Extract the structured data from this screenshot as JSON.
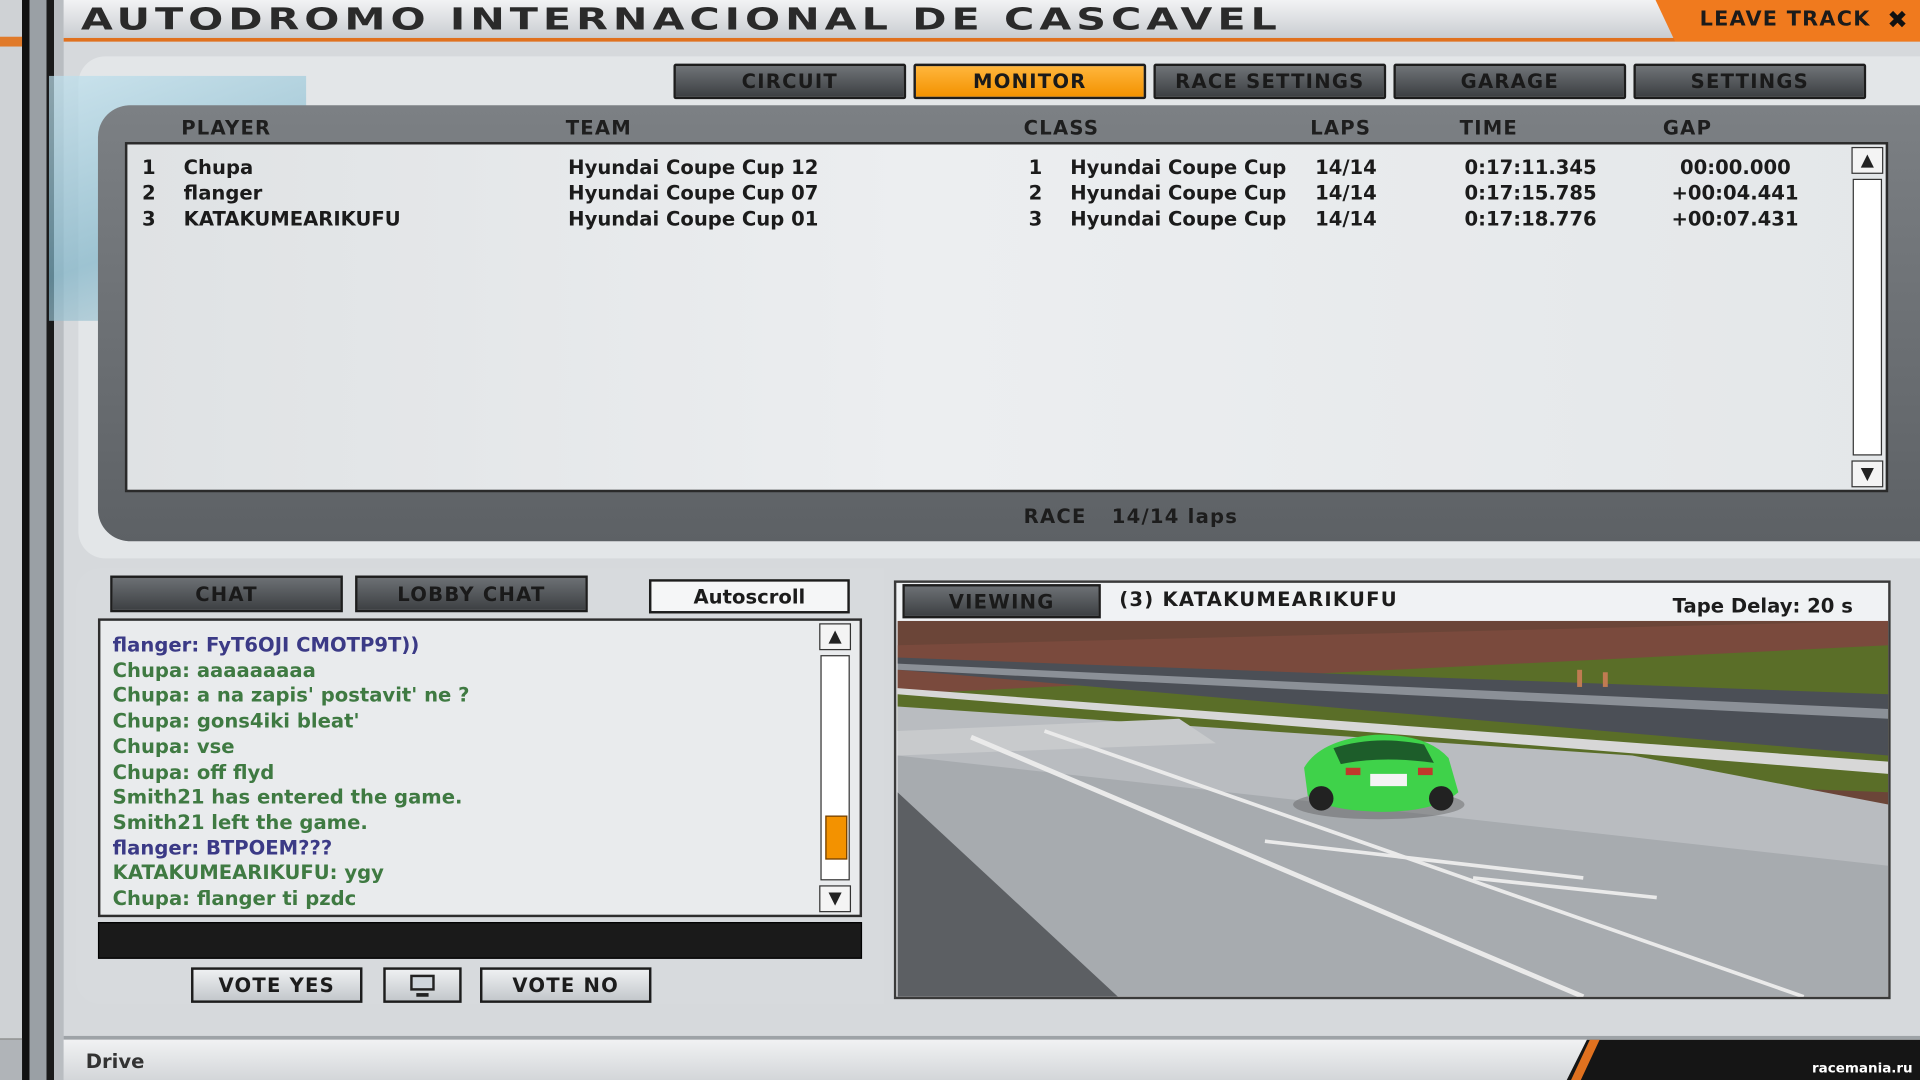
{
  "window": {
    "title": "AUTODROMO INTERNACIONAL DE CASCAVEL",
    "leave_label": "LEAVE TRACK"
  },
  "tabs": [
    {
      "label": "CIRCUIT",
      "active": false
    },
    {
      "label": "MONITOR",
      "active": true
    },
    {
      "label": "RACE SETTINGS",
      "active": false
    },
    {
      "label": "GARAGE",
      "active": false
    },
    {
      "label": "SETTINGS",
      "active": false
    }
  ],
  "standings": {
    "columns": {
      "player": "PLAYER",
      "team": "TEAM",
      "class": "CLASS",
      "laps": "LAPS",
      "time": "TIME",
      "gap": "GAP"
    },
    "rows": [
      {
        "pos": "1",
        "player": "Chupa",
        "team": "Hyundai Coupe Cup 12",
        "class_pos": "1",
        "class": "Hyundai Coupe Cup",
        "laps": "14/14",
        "time": "0:17:11.345",
        "gap": "00:00.000"
      },
      {
        "pos": "2",
        "player": "flanger",
        "team": "Hyundai Coupe Cup 07",
        "class_pos": "2",
        "class": "Hyundai Coupe Cup",
        "laps": "14/14",
        "time": "0:17:15.785",
        "gap": "+00:04.441"
      },
      {
        "pos": "3",
        "player": "KATAKUMEARIKUFU",
        "team": "Hyundai Coupe Cup 01",
        "class_pos": "3",
        "class": "Hyundai Coupe Cup",
        "laps": "14/14",
        "time": "0:17:18.776",
        "gap": "+00:07.431"
      }
    ],
    "session": "RACE",
    "session_laps": "14/14 laps"
  },
  "chat": {
    "tab_chat": "CHAT",
    "tab_lobby": "LOBBY CHAT",
    "autoscroll": "Autoscroll",
    "scroll_position": 0.9,
    "messages": [
      {
        "text": "flanger: FyT6OJI CMOTP9T))",
        "color": "#3b3a86"
      },
      {
        "text": "Chupa: aaaaaaaaa",
        "color": "#3f7a42"
      },
      {
        "text": "Chupa: a na zapis' postavit' ne ?",
        "color": "#3f7a42"
      },
      {
        "text": "Chupa: gons4iki bleat'",
        "color": "#3f7a42"
      },
      {
        "text": "Chupa: vse",
        "color": "#3f7a42"
      },
      {
        "text": "Chupa: off flyd",
        "color": "#3f7a42"
      },
      {
        "text": "Smith21 has entered the game.",
        "color": "#3f7a42"
      },
      {
        "text": "Smith21 left the game.",
        "color": "#3f7a42"
      },
      {
        "text": "flanger: BTPOEM???",
        "color": "#3b3a86"
      },
      {
        "text": "KATAKUMEARIKUFU: ygy",
        "color": "#3f7a42"
      },
      {
        "text": "Chupa: flanger ti pzdc",
        "color": "#3f7a42"
      }
    ],
    "input_value": "",
    "vote_yes": "VOTE YES",
    "vote_no": "VOTE NO",
    "vote_icon": "monitor-icon"
  },
  "viewer": {
    "button": "VIEWING",
    "driver": "(3) KATAKUMEARIKUFU",
    "tape_delay": "Tape Delay: 20 s"
  },
  "status": {
    "text": "Drive",
    "watermark": "racemania.ru"
  },
  "colors": {
    "accent": "#f39200",
    "chat_green": "#3f7a42",
    "chat_blue": "#3b3a86",
    "car": "#3fd24a"
  }
}
